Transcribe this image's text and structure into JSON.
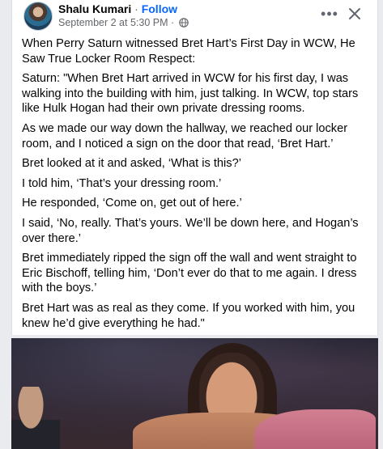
{
  "post": {
    "author": "Shalu Kumari",
    "separator": "·",
    "follow_label": "Follow",
    "timestamp": "September 2 at 5:30 PM",
    "meta_separator": "·",
    "privacy_icon": "globe-icon",
    "more_label": "•••",
    "close_icon": "close-icon"
  },
  "text": {
    "p1": "When Perry Saturn witnessed Bret Hart’s First Day in WCW, He Saw True Locker Room Respect:",
    "p2": "Saturn: \"When Bret Hart arrived in WCW for his first day, I was walking into the building with him, just talking. In WCW, top stars like Hulk Hogan had their own private dressing rooms.",
    "p3": "As we made our way down the hallway, we reached our locker room, and I noticed a sign on the door that read, ‘Bret Hart.’",
    "p4": "Bret looked at it and asked, ‘What is this?’",
    "p5": "I told him, ‘That’s your dressing room.’",
    "p6": "He responded, ‘Come on, get out of here.’",
    "p7": "I said, ‘No, really. That’s yours. We’ll be down here, and Hogan’s over there.’",
    "p8": "Bret immediately ripped the sign off the wall and went straight to Eric Bischoff, telling him, ‘Don’t ever do that to me again. I dress with the boys.’",
    "p9": "Bret Hart was as real as they come. If you worked with him, you knew he’d give everything he had.\""
  },
  "colors": {
    "link": "#0866ff",
    "text": "#050505",
    "secondary": "#65676b",
    "background": "#e9ebee"
  }
}
